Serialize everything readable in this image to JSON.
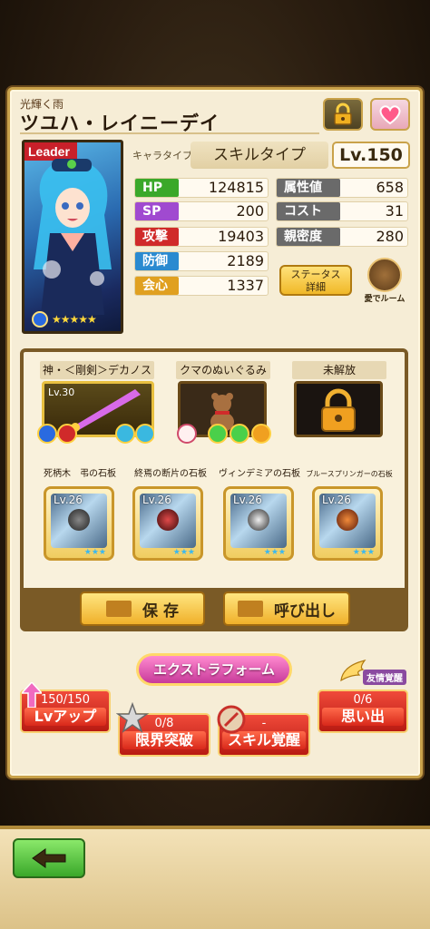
{
  "header": {
    "subtitle": "光輝く雨",
    "name": "ツユハ・レイニーデイ"
  },
  "portrait": {
    "leader_tag": "Leader",
    "stars": "★★★★★"
  },
  "type_row": {
    "label": "キャラタイプ",
    "value": "スキルタイプ",
    "level": "Lv.150"
  },
  "stats": [
    {
      "label": "HP",
      "value": "124815",
      "color": "#3aa82a"
    },
    {
      "label": "SP",
      "value": "200",
      "color": "#a04ad0"
    },
    {
      "label": "攻撃",
      "value": "19403",
      "color": "#d02a2a"
    },
    {
      "label": "防御",
      "value": "2189",
      "color": "#2a8ad0"
    },
    {
      "label": "会心",
      "value": "1337",
      "color": "#e0a020"
    }
  ],
  "stats_right": [
    {
      "label": "属性値",
      "value": "658"
    },
    {
      "label": "コスト",
      "value": "31"
    },
    {
      "label": "親密度",
      "value": "280"
    }
  ],
  "buttons": {
    "status_detail": "ステータス\n詳細",
    "room": "愛でルーム",
    "save": "保 存",
    "load": "呼び出し",
    "extra_form": "エクストラフォーム"
  },
  "equipment": [
    {
      "label": "神・＜剛剣＞デカノス",
      "level": "Lv.30"
    },
    {
      "label": "クマのぬいぐるみ"
    },
    {
      "label": "未解放"
    }
  ],
  "tablets": [
    {
      "label": "死柄木　弔の石板",
      "level": "Lv.26",
      "stars": "★★★"
    },
    {
      "label": "終焉の断片の石板",
      "level": "Lv.26",
      "stars": "★★★"
    },
    {
      "label": "ヴィンデミアの石板",
      "level": "Lv.26",
      "stars": "★★★"
    },
    {
      "label": "ブルースプリンガーの石板",
      "level": "Lv.26",
      "stars": "★★★"
    }
  ],
  "actions": {
    "lvup": {
      "count": "150/150",
      "label": "Lvアップ"
    },
    "limit": {
      "count": "0/8",
      "label": "限界突破"
    },
    "skill": {
      "count": "-",
      "label": "スキル覚醒"
    },
    "memory": {
      "count": "0/6",
      "label": "思い出",
      "tag": "友情覚醒"
    }
  }
}
